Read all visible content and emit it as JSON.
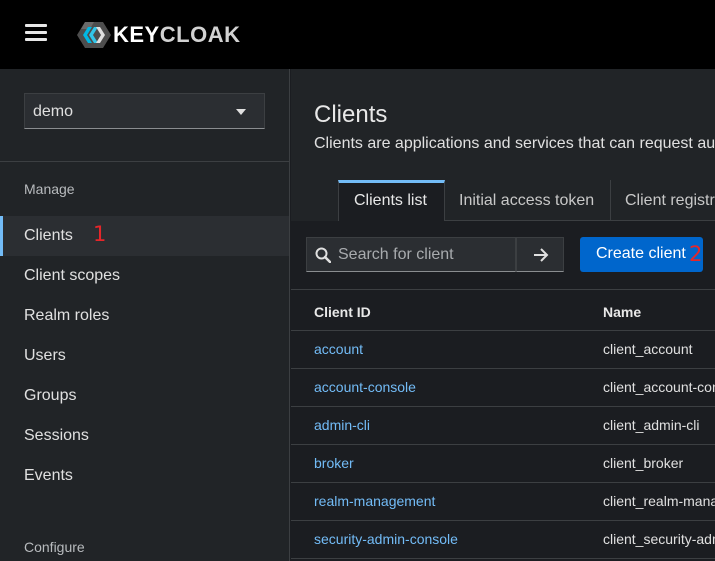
{
  "app": {
    "logo_text_key": "KEY",
    "logo_text_rest": "CLOAK"
  },
  "sidebar": {
    "realm": "demo",
    "sections": {
      "manage": "Manage",
      "configure": "Configure"
    },
    "items": [
      {
        "label": "Clients",
        "active": true
      },
      {
        "label": "Client scopes"
      },
      {
        "label": "Realm roles"
      },
      {
        "label": "Users"
      },
      {
        "label": "Groups"
      },
      {
        "label": "Sessions"
      },
      {
        "label": "Events"
      }
    ],
    "annotation": "1"
  },
  "page": {
    "title": "Clients",
    "description": "Clients are applications and services that can request authentication of a user."
  },
  "tabs": [
    {
      "label": "Clients list",
      "active": true
    },
    {
      "label": "Initial access token"
    },
    {
      "label": "Client registration"
    }
  ],
  "toolbar": {
    "search_placeholder": "Search for client",
    "create_label": "Create client",
    "annotation": "2"
  },
  "table": {
    "columns": [
      "Client ID",
      "Name"
    ],
    "rows": [
      {
        "client_id": "account",
        "name": "client_account"
      },
      {
        "client_id": "account-console",
        "name": "client_account-console"
      },
      {
        "client_id": "admin-cli",
        "name": "client_admin-cli"
      },
      {
        "client_id": "broker",
        "name": "client_broker"
      },
      {
        "client_id": "realm-management",
        "name": "client_realm-management"
      },
      {
        "client_id": "security-admin-console",
        "name": "client_security-admin-console"
      }
    ]
  },
  "colors": {
    "link": "#73bcf7",
    "primary": "#0066cc",
    "annotation": "#e5262a"
  }
}
